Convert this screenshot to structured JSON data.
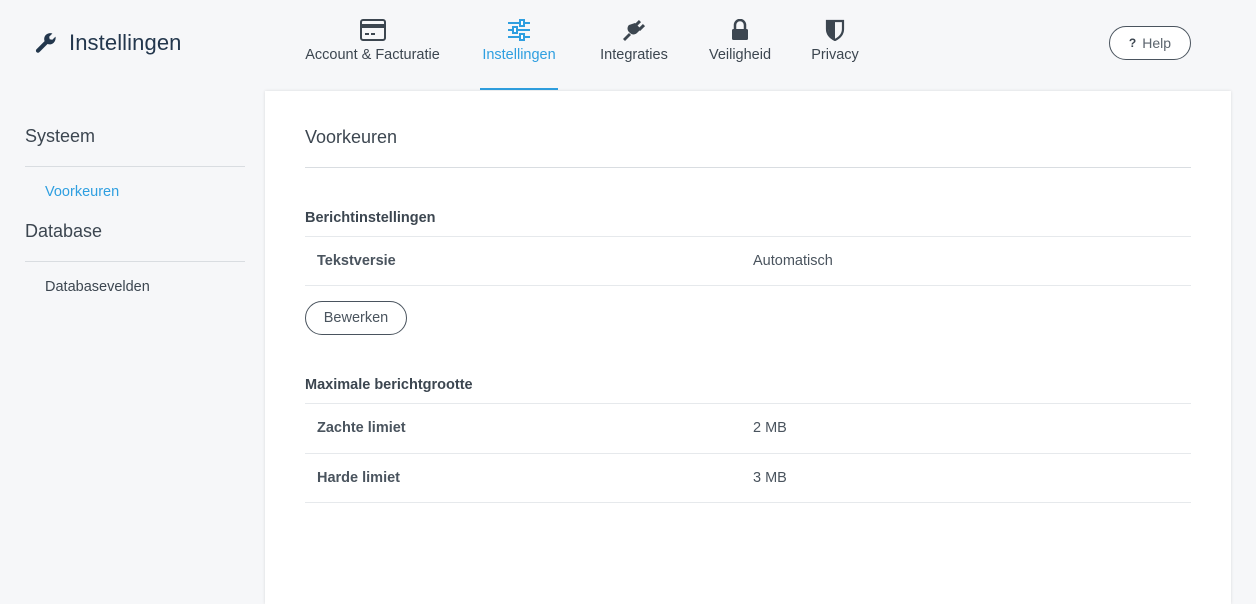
{
  "app": {
    "title": "Instellingen"
  },
  "nav": {
    "items": [
      {
        "label": "Account & Facturatie",
        "icon": "credit-card-icon",
        "active": false
      },
      {
        "label": "Instellingen",
        "icon": "sliders-icon",
        "active": true
      },
      {
        "label": "Integraties",
        "icon": "plug-icon",
        "active": false
      },
      {
        "label": "Veiligheid",
        "icon": "lock-icon",
        "active": false
      },
      {
        "label": "Privacy",
        "icon": "shield-icon",
        "active": false
      }
    ]
  },
  "help": {
    "label": "Help",
    "icon": "question-icon"
  },
  "sidebar": {
    "sections": [
      {
        "heading": "Systeem",
        "items": [
          {
            "label": "Voorkeuren",
            "active": true
          }
        ]
      },
      {
        "heading": "Database",
        "items": [
          {
            "label": "Databasevelden",
            "active": false
          }
        ]
      }
    ]
  },
  "main": {
    "title": "Voorkeuren",
    "message_settings": {
      "heading": "Berichtinstellingen",
      "rows": [
        {
          "label": "Tekstversie",
          "value": "Automatisch"
        }
      ],
      "edit_label": "Bewerken"
    },
    "max_size": {
      "heading": "Maximale berichtgrootte",
      "rows": [
        {
          "label": "Zachte limiet",
          "value": "2 MB"
        },
        {
          "label": "Harde limiet",
          "value": "3 MB"
        }
      ]
    }
  },
  "colors": {
    "accent": "#2f9fe0",
    "text": "#3c4650",
    "brand": "#23374d",
    "background": "#f6f7f9"
  }
}
